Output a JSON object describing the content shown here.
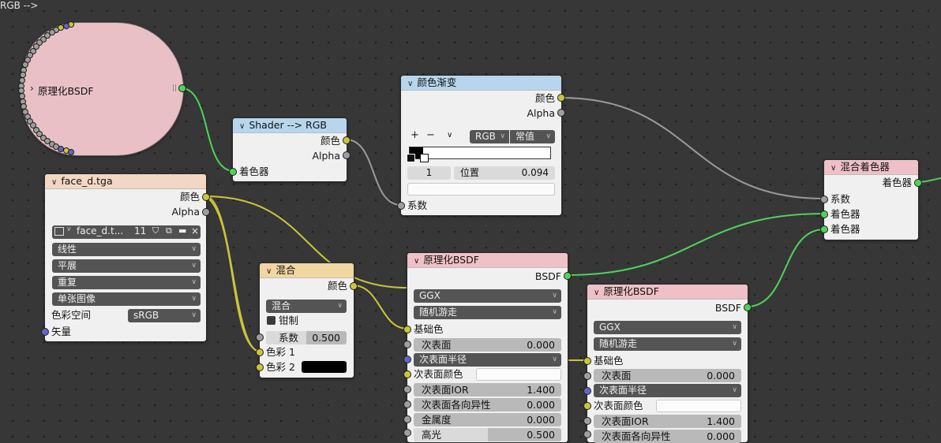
{
  "frame_node": {
    "title": "原理化BSDF",
    "collapse_icon": "chevron-right-icon"
  },
  "shader_rgb": {
    "title": "Shader --> RGB",
    "out_color": "颜色",
    "out_alpha": "Alpha",
    "in_shader": "着色器"
  },
  "color_ramp": {
    "title": "颜色渐变",
    "out_color": "颜色",
    "out_alpha": "Alpha",
    "add": "+",
    "remove": "−",
    "menu": "∨",
    "color_mode": "RGB",
    "interpolation": "常值",
    "stop_index": "1",
    "pos_label": "位置",
    "pos_value": "0.094",
    "in_fac": "系数"
  },
  "image_tex": {
    "title": "face_d.tga",
    "out_color": "颜色",
    "out_alpha": "Alpha",
    "image_name": "face_d.t...",
    "users": "11",
    "interpolation": "线性",
    "projection": "平展",
    "extension": "重复",
    "source": "单张图像",
    "colorspace_label": "色彩空间",
    "colorspace": "sRGB",
    "in_vector": "矢量"
  },
  "mix": {
    "title": "混合",
    "out_color": "颜色",
    "blend": "混合",
    "clamp": "钳制",
    "fac_label": "系数",
    "fac_value": "0.500",
    "color1": "色彩 1",
    "color2": "色彩 2"
  },
  "bsdf1": {
    "title": "原理化BSDF",
    "out": "BSDF",
    "distribution": "GGX",
    "sss_method": "随机游走",
    "base_color": "基础色",
    "subsurface": "次表面",
    "subsurface_value": "0.000",
    "subsurface_radius": "次表面半径",
    "subsurface_color": "次表面颜色",
    "subsurface_ior": "次表面IOR",
    "subsurface_ior_value": "1.400",
    "subsurface_aniso": "次表面各向异性",
    "subsurface_aniso_value": "0.000",
    "metallic": "金属度",
    "metallic_value": "0.000",
    "specular": "高光",
    "specular_value": "0.500"
  },
  "bsdf2": {
    "title": "原理化BSDF",
    "out": "BSDF",
    "distribution": "GGX",
    "sss_method": "随机游走",
    "base_color": "基础色",
    "subsurface": "次表面",
    "subsurface_value": "0.000",
    "subsurface_radius": "次表面半径",
    "subsurface_color": "次表面颜色",
    "subsurface_ior": "次表面IOR",
    "subsurface_ior_value": "1.400",
    "subsurface_aniso": "次表面各向异性",
    "subsurface_aniso_value": "0.000"
  },
  "mix_shader": {
    "title": "混合着色器",
    "out": "着色器",
    "in_fac": "系数",
    "in_shader1": "着色器",
    "in_shader2": "着色器"
  },
  "colors": {
    "shader_socket": "#4fd35a",
    "color_socket": "#c9c63a",
    "value_socket": "#9e9e9e",
    "vector_socket": "#6464c8",
    "header_input": "#f2d8c3",
    "header_converter": "#b7d6ee",
    "header_color": "#f2d6a1",
    "header_shader": "#efc0c7",
    "frame_pink": "#e8c0c6"
  }
}
